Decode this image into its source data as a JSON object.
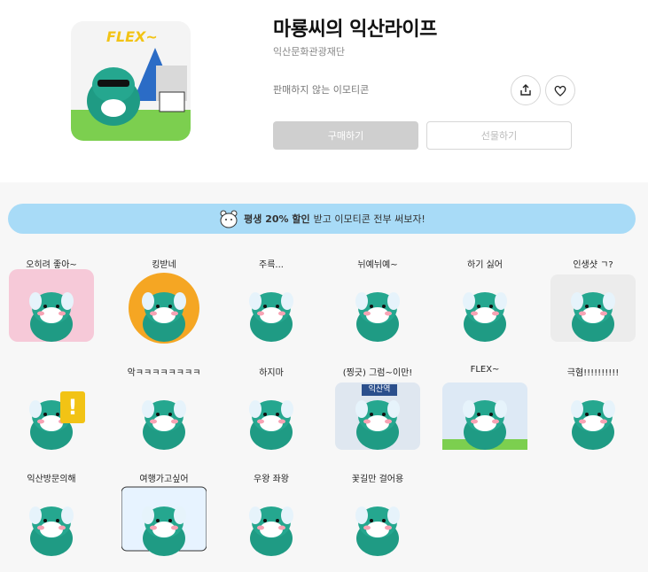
{
  "product": {
    "title": "마룡씨의 익산라이프",
    "publisher": "익산문화관광재단",
    "sale_notice": "판매하지 않는 이모티콘",
    "buy_label": "구매하기",
    "gift_label": "선물하기"
  },
  "icons": {
    "share": "share-icon",
    "like": "heart-icon",
    "banner": "bear-icon"
  },
  "banner": {
    "highlight": "평생 20% 할인",
    "rest": "받고 이모티콘 전부 써보자!"
  },
  "colors": {
    "dragon_teal": "#1f9b84",
    "banner_bg": "#a8dbf7",
    "buy_button": "#cfcfcf",
    "section_bg": "#f7f7f7"
  },
  "main_thumb_caption": "FLEX~",
  "stickers": [
    {
      "caption": "오히려 좋아~"
    },
    {
      "caption": "킹받네"
    },
    {
      "caption": "주륵..."
    },
    {
      "caption": "뉘예뉘예~"
    },
    {
      "caption": "하기 싫어"
    },
    {
      "caption": "인생샷 ㄱ?"
    },
    {
      "caption": "",
      "sign": "!"
    },
    {
      "caption": "악ㅋㅋㅋㅋㅋㅋㅋㅋ"
    },
    {
      "caption": "하지마"
    },
    {
      "caption": "(찡긋) 그럼~이만!",
      "sign": "익산역"
    },
    {
      "caption": "FLEX~"
    },
    {
      "caption": "극혐!!!!!!!!!!"
    },
    {
      "caption": "익산방문의해"
    },
    {
      "caption": "여행가고싶어"
    },
    {
      "caption": "우왕        좌왕"
    },
    {
      "caption": "꽃길만 걸어용"
    }
  ]
}
